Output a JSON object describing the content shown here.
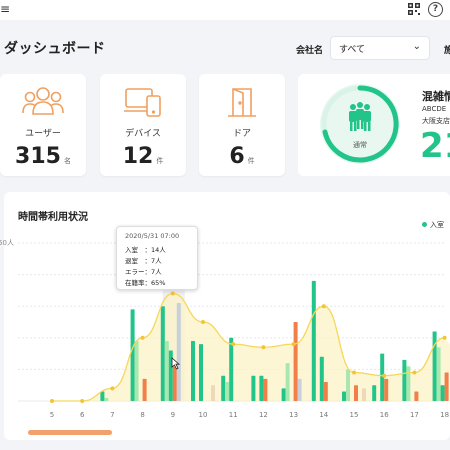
{
  "topbar": {
    "menu": "≡",
    "help": "?"
  },
  "header": {
    "title": "ダッシュボード",
    "company_label": "会社名",
    "company_value": "すべて",
    "cut_label": "施"
  },
  "stats": [
    {
      "label": "ユーザー",
      "value": "315",
      "unit": "名",
      "icon": "users-icon"
    },
    {
      "label": "デバイス",
      "value": "12",
      "unit": "件",
      "icon": "devices-icon"
    },
    {
      "label": "ドア",
      "value": "6",
      "unit": "件",
      "icon": "door-icon"
    }
  ],
  "congestion": {
    "title": "混雑情",
    "line1": "ABCDE",
    "line2": "大阪支店",
    "value": "21",
    "status": "通常"
  },
  "chart": {
    "title": "時間帯利用状況",
    "legend_entry": "入室",
    "ymax_label": "50人"
  },
  "tooltip": {
    "timestamp": "2020/5/31 07:00",
    "row1": "入室　：14人",
    "row2": "退室　：7人",
    "row3": "エラー：7人",
    "row4": "在籍率：65%"
  },
  "colors": {
    "green": "#22c48a",
    "orange": "#f07f4a",
    "grey": "#c9d0dc",
    "yellow": "#f6d75a",
    "lightgreen": "#a8e8b0",
    "beige": "#eed8b8",
    "icon": "#f0a060"
  },
  "chart_data": {
    "type": "bar",
    "categories": [
      "5",
      "6",
      "7",
      "8",
      "9",
      "10",
      "11",
      "12",
      "13",
      "14",
      "15",
      "16",
      "17",
      "18"
    ],
    "series": [
      {
        "name": "入室",
        "values": [
          0,
          0,
          3,
          29,
          30,
          19,
          8,
          8,
          4,
          38,
          3,
          5,
          13,
          22
        ]
      },
      {
        "values": [
          0,
          0,
          1,
          19,
          19,
          0,
          6,
          0,
          12,
          0,
          10,
          0,
          11,
          17
        ]
      },
      {
        "values": [
          0,
          0,
          0,
          0,
          16,
          18,
          20,
          8,
          0,
          14,
          0,
          15,
          0,
          5
        ]
      },
      {
        "values": [
          0,
          0,
          0,
          7,
          11,
          0,
          0,
          7,
          25,
          6,
          5,
          7,
          3,
          9
        ]
      },
      {
        "values": [
          0,
          0,
          0,
          0,
          31,
          0,
          0,
          0,
          7,
          0,
          0,
          0,
          0,
          0
        ]
      },
      {
        "values": [
          0,
          0,
          0,
          0,
          0,
          5,
          0,
          0,
          0,
          0,
          4,
          0,
          0,
          3
        ]
      }
    ],
    "line": [
      0,
      0,
      4,
      20,
      34,
      25,
      18,
      17,
      18,
      30,
      9,
      8,
      9,
      20
    ],
    "ylim": [
      0,
      50
    ],
    "ylabel": "50人"
  }
}
